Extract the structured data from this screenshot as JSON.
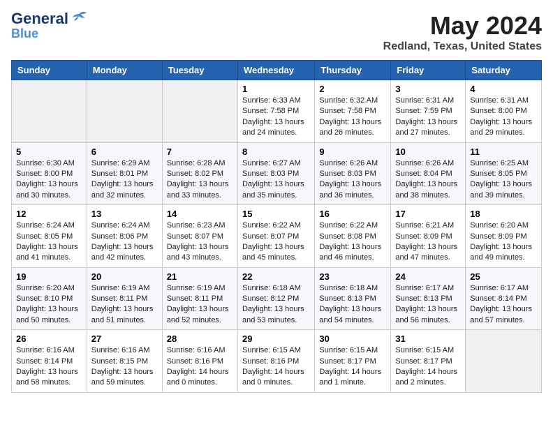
{
  "header": {
    "logo_general": "General",
    "logo_blue": "Blue",
    "title": "May 2024",
    "subtitle": "Redland, Texas, United States"
  },
  "days_of_week": [
    "Sunday",
    "Monday",
    "Tuesday",
    "Wednesday",
    "Thursday",
    "Friday",
    "Saturday"
  ],
  "weeks": [
    [
      {
        "day": "",
        "info": ""
      },
      {
        "day": "",
        "info": ""
      },
      {
        "day": "",
        "info": ""
      },
      {
        "day": "1",
        "info": "Sunrise: 6:33 AM\nSunset: 7:58 PM\nDaylight: 13 hours\nand 24 minutes."
      },
      {
        "day": "2",
        "info": "Sunrise: 6:32 AM\nSunset: 7:58 PM\nDaylight: 13 hours\nand 26 minutes."
      },
      {
        "day": "3",
        "info": "Sunrise: 6:31 AM\nSunset: 7:59 PM\nDaylight: 13 hours\nand 27 minutes."
      },
      {
        "day": "4",
        "info": "Sunrise: 6:31 AM\nSunset: 8:00 PM\nDaylight: 13 hours\nand 29 minutes."
      }
    ],
    [
      {
        "day": "5",
        "info": "Sunrise: 6:30 AM\nSunset: 8:00 PM\nDaylight: 13 hours\nand 30 minutes."
      },
      {
        "day": "6",
        "info": "Sunrise: 6:29 AM\nSunset: 8:01 PM\nDaylight: 13 hours\nand 32 minutes."
      },
      {
        "day": "7",
        "info": "Sunrise: 6:28 AM\nSunset: 8:02 PM\nDaylight: 13 hours\nand 33 minutes."
      },
      {
        "day": "8",
        "info": "Sunrise: 6:27 AM\nSunset: 8:03 PM\nDaylight: 13 hours\nand 35 minutes."
      },
      {
        "day": "9",
        "info": "Sunrise: 6:26 AM\nSunset: 8:03 PM\nDaylight: 13 hours\nand 36 minutes."
      },
      {
        "day": "10",
        "info": "Sunrise: 6:26 AM\nSunset: 8:04 PM\nDaylight: 13 hours\nand 38 minutes."
      },
      {
        "day": "11",
        "info": "Sunrise: 6:25 AM\nSunset: 8:05 PM\nDaylight: 13 hours\nand 39 minutes."
      }
    ],
    [
      {
        "day": "12",
        "info": "Sunrise: 6:24 AM\nSunset: 8:05 PM\nDaylight: 13 hours\nand 41 minutes."
      },
      {
        "day": "13",
        "info": "Sunrise: 6:24 AM\nSunset: 8:06 PM\nDaylight: 13 hours\nand 42 minutes."
      },
      {
        "day": "14",
        "info": "Sunrise: 6:23 AM\nSunset: 8:07 PM\nDaylight: 13 hours\nand 43 minutes."
      },
      {
        "day": "15",
        "info": "Sunrise: 6:22 AM\nSunset: 8:07 PM\nDaylight: 13 hours\nand 45 minutes."
      },
      {
        "day": "16",
        "info": "Sunrise: 6:22 AM\nSunset: 8:08 PM\nDaylight: 13 hours\nand 46 minutes."
      },
      {
        "day": "17",
        "info": "Sunrise: 6:21 AM\nSunset: 8:09 PM\nDaylight: 13 hours\nand 47 minutes."
      },
      {
        "day": "18",
        "info": "Sunrise: 6:20 AM\nSunset: 8:09 PM\nDaylight: 13 hours\nand 49 minutes."
      }
    ],
    [
      {
        "day": "19",
        "info": "Sunrise: 6:20 AM\nSunset: 8:10 PM\nDaylight: 13 hours\nand 50 minutes."
      },
      {
        "day": "20",
        "info": "Sunrise: 6:19 AM\nSunset: 8:11 PM\nDaylight: 13 hours\nand 51 minutes."
      },
      {
        "day": "21",
        "info": "Sunrise: 6:19 AM\nSunset: 8:11 PM\nDaylight: 13 hours\nand 52 minutes."
      },
      {
        "day": "22",
        "info": "Sunrise: 6:18 AM\nSunset: 8:12 PM\nDaylight: 13 hours\nand 53 minutes."
      },
      {
        "day": "23",
        "info": "Sunrise: 6:18 AM\nSunset: 8:13 PM\nDaylight: 13 hours\nand 54 minutes."
      },
      {
        "day": "24",
        "info": "Sunrise: 6:17 AM\nSunset: 8:13 PM\nDaylight: 13 hours\nand 56 minutes."
      },
      {
        "day": "25",
        "info": "Sunrise: 6:17 AM\nSunset: 8:14 PM\nDaylight: 13 hours\nand 57 minutes."
      }
    ],
    [
      {
        "day": "26",
        "info": "Sunrise: 6:16 AM\nSunset: 8:14 PM\nDaylight: 13 hours\nand 58 minutes."
      },
      {
        "day": "27",
        "info": "Sunrise: 6:16 AM\nSunset: 8:15 PM\nDaylight: 13 hours\nand 59 minutes."
      },
      {
        "day": "28",
        "info": "Sunrise: 6:16 AM\nSunset: 8:16 PM\nDaylight: 14 hours\nand 0 minutes."
      },
      {
        "day": "29",
        "info": "Sunrise: 6:15 AM\nSunset: 8:16 PM\nDaylight: 14 hours\nand 0 minutes."
      },
      {
        "day": "30",
        "info": "Sunrise: 6:15 AM\nSunset: 8:17 PM\nDaylight: 14 hours\nand 1 minute."
      },
      {
        "day": "31",
        "info": "Sunrise: 6:15 AM\nSunset: 8:17 PM\nDaylight: 14 hours\nand 2 minutes."
      },
      {
        "day": "",
        "info": ""
      }
    ]
  ]
}
